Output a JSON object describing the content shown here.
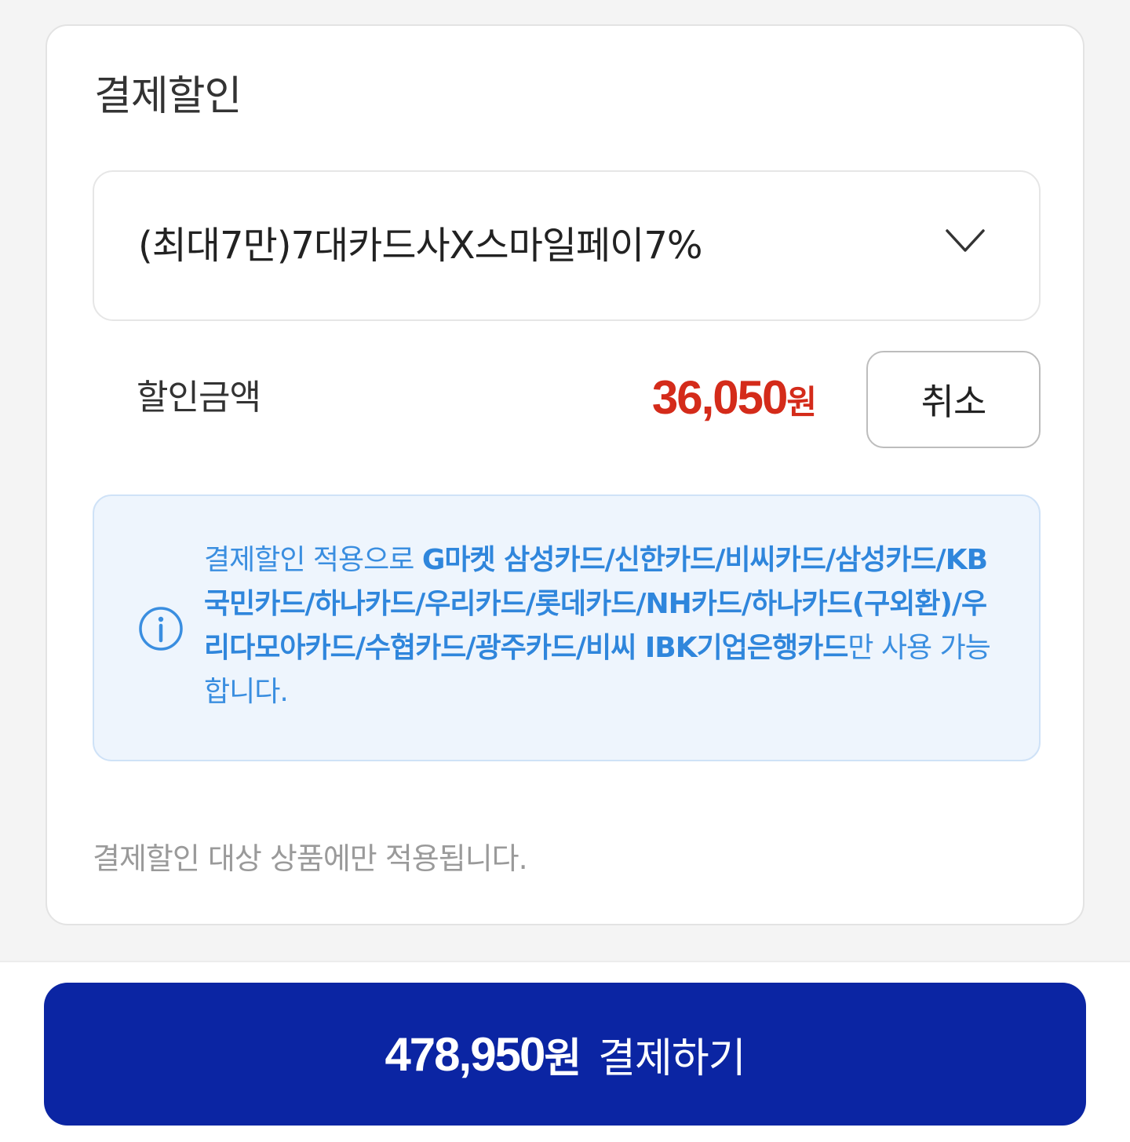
{
  "discount_section": {
    "title": "결제할인",
    "selected_option": "(최대7만)7대카드사X스마일페이7%",
    "amount_label": "할인금액",
    "amount_value": "36,050",
    "amount_unit": "원",
    "cancel_label": "취소",
    "info": {
      "prefix": "결제할인 적용으로 ",
      "cards": "G마켓 삼성카드/신한카드/비씨카드/삼성카드/KB국민카드/하나카드/우리카드/롯데카드/NH카드/하나카드(구외환)/우리다모아카드/수협카드/광주카드/비씨 IBK기업은행카드",
      "suffix": "만 사용 가능합니다."
    },
    "footnote": "결제할인 대상 상품에만 적용됩니다."
  },
  "pay_button": {
    "amount": "478,950",
    "unit": "원",
    "label": "결제하기"
  },
  "colors": {
    "discount_red": "#d42b1a",
    "info_blue": "#3a8ee0",
    "info_bg": "#eef5fd",
    "pay_button_bg": "#0b25a3"
  },
  "icons": {
    "select_arrow": "chevron-down-icon",
    "info": "info-circle-icon"
  }
}
